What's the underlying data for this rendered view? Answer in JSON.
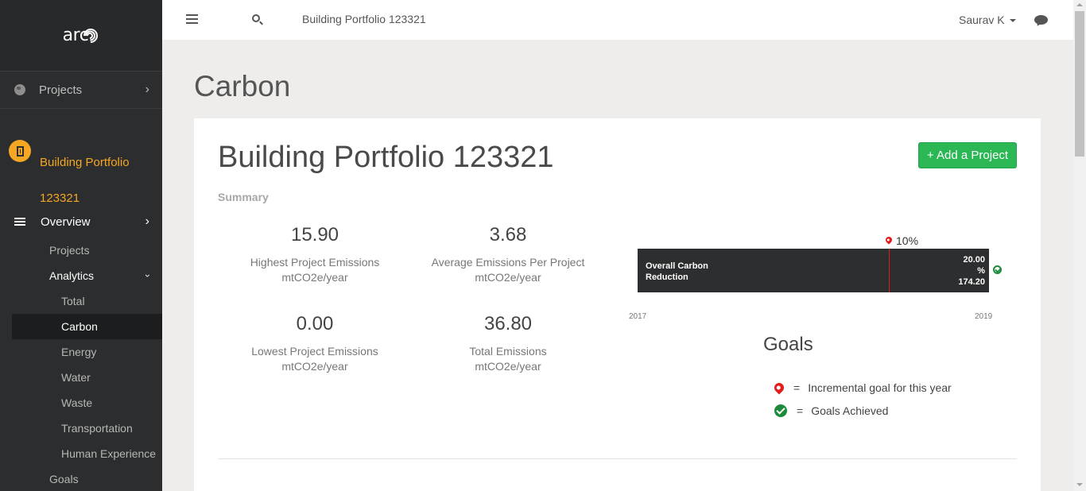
{
  "sidebar": {
    "logo": "arc",
    "projects_label": "Projects",
    "portfolio_name_line1": "Building Portfolio",
    "portfolio_name_line2": "123321",
    "overview_label": "Overview",
    "items": [
      {
        "label": "Projects"
      },
      {
        "label": "Analytics"
      },
      {
        "label": "Total"
      },
      {
        "label": "Carbon"
      },
      {
        "label": "Energy"
      },
      {
        "label": "Water"
      },
      {
        "label": "Waste"
      },
      {
        "label": "Transportation"
      },
      {
        "label": "Human Experience"
      },
      {
        "label": "Goals"
      }
    ]
  },
  "topbar": {
    "title": "Building Portfolio 123321",
    "user": "Saurav K"
  },
  "page": {
    "title": "Carbon"
  },
  "card": {
    "title": "Building Portfolio 123321",
    "add_button": "+ Add a Project",
    "summary_label": "Summary",
    "stats": [
      {
        "value": "15.90",
        "label": "Highest Project Emissions",
        "unit": "mtCO2e/year"
      },
      {
        "value": "3.68",
        "label": "Average Emissions Per Project",
        "unit": "mtCO2e/year"
      },
      {
        "value": "0.00",
        "label": "Lowest Project Emissions",
        "unit": "mtCO2e/year"
      },
      {
        "value": "36.80",
        "label": "Total Emissions",
        "unit": "mtCO2e/year"
      }
    ],
    "progress": {
      "goal_marker": "10%",
      "bar_label_line1": "Overall Carbon",
      "bar_label_line2": "Reduction",
      "value_line1": "20.00",
      "value_line2": "%",
      "value_line3": "174.20",
      "year_start": "2017",
      "year_end": "2019"
    },
    "goals": {
      "title": "Goals",
      "legend_eq": "=",
      "legend_incremental": "Incremental goal for this year",
      "legend_achieved": "Goals Achieved"
    }
  },
  "colors": {
    "accent": "#f5a623",
    "button_green": "#2ab754",
    "marker_red": "#e41b1b",
    "achieved_green": "#1c8a3a",
    "sidebar_bg": "#2b2d2e"
  }
}
